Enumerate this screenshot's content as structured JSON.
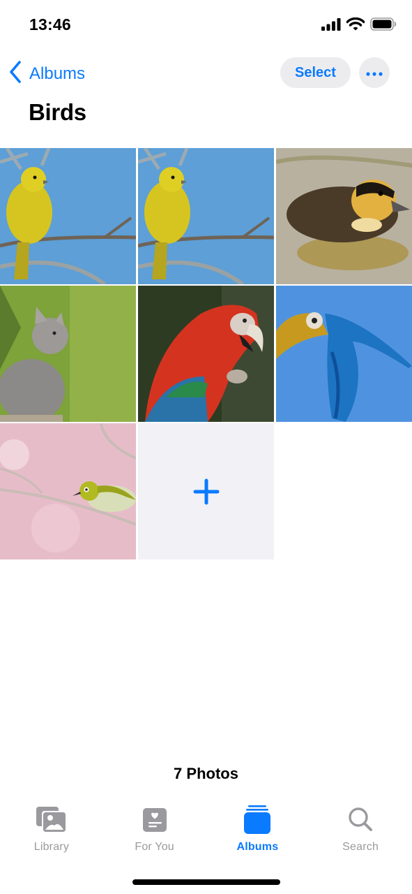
{
  "status_bar": {
    "time": "13:46",
    "icons": [
      "cellular-signal-icon",
      "wifi-icon",
      "battery-icon"
    ]
  },
  "nav": {
    "back_label": "Albums",
    "back_icon": "chevron-left-icon",
    "select_label": "Select",
    "more_icon": "ellipsis-icon"
  },
  "album": {
    "title": "Birds",
    "photo_count_label": "7 Photos",
    "photos": [
      {
        "subject": "yellow canary on branch"
      },
      {
        "subject": "yellow canary on branch"
      },
      {
        "subject": "duckling swimming"
      },
      {
        "subject": "grey kitten"
      },
      {
        "subject": "red macaw"
      },
      {
        "subject": "blue-and-yellow macaw in flight"
      },
      {
        "subject": "white-eye bird on blossom branch"
      }
    ],
    "add_icon": "plus-icon"
  },
  "tab_bar": {
    "tabs": [
      {
        "label": "Library",
        "icon": "photo-library-icon",
        "active": false
      },
      {
        "label": "For You",
        "icon": "for-you-icon",
        "active": false
      },
      {
        "label": "Albums",
        "icon": "albums-icon",
        "active": true
      },
      {
        "label": "Search",
        "icon": "search-icon",
        "active": false
      }
    ]
  },
  "colors": {
    "accent": "#0a7aff",
    "inactive_tab": "#9a9a9e",
    "button_bg": "#ececef",
    "add_cell_bg": "#f1f1f6"
  }
}
